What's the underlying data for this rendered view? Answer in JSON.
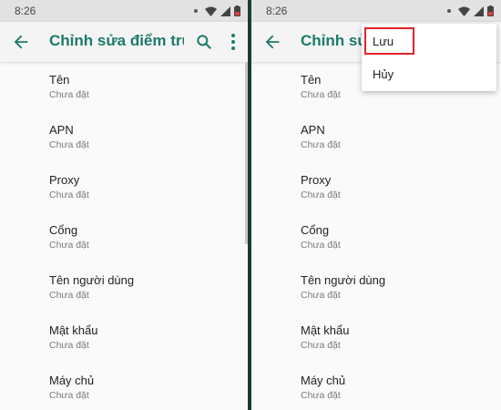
{
  "status": {
    "time": "8:26"
  },
  "title": "Chỉnh sửa điểm truy cập",
  "fields": [
    {
      "title": "Tên",
      "summary": "Chưa đặt"
    },
    {
      "title": "APN",
      "summary": "Chưa đặt"
    },
    {
      "title": "Proxy",
      "summary": "Chưa đặt"
    },
    {
      "title": "Cổng",
      "summary": "Chưa đặt"
    },
    {
      "title": "Tên người dùng",
      "summary": "Chưa đặt"
    },
    {
      "title": "Mật khẩu",
      "summary": "Chưa đặt"
    },
    {
      "title": "Máy chủ",
      "summary": "Chưa đặt"
    }
  ],
  "menu": {
    "save": "Lưu",
    "cancel": "Hủy"
  },
  "colors": {
    "accent": "#1b7a6b",
    "highlight": "#e3242b",
    "divider": "#1b3d36"
  },
  "icons": [
    "back-arrow-icon",
    "search-icon",
    "more-vert-icon",
    "wifi-icon",
    "signal-icon",
    "battery-icon"
  ]
}
